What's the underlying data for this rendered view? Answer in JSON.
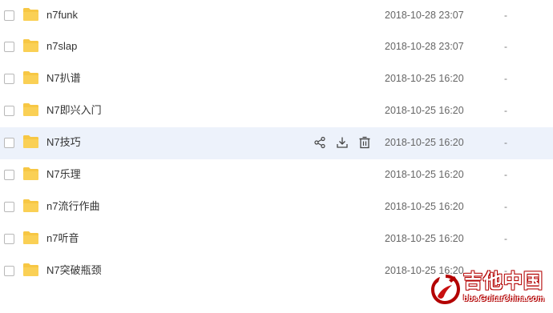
{
  "files": [
    {
      "name": "n7funk",
      "modified": "2018-10-28 23:07",
      "size": "-",
      "type": "folder"
    },
    {
      "name": "n7slap",
      "modified": "2018-10-28 23:07",
      "size": "-",
      "type": "folder"
    },
    {
      "name": "N7扒谱",
      "modified": "2018-10-25 16:20",
      "size": "-",
      "type": "folder"
    },
    {
      "name": "N7即兴入门",
      "modified": "2018-10-25 16:20",
      "size": "-",
      "type": "folder"
    },
    {
      "name": "N7技巧",
      "modified": "2018-10-25 16:20",
      "size": "-",
      "type": "folder",
      "hovered": true
    },
    {
      "name": "N7乐理",
      "modified": "2018-10-25 16:20",
      "size": "-",
      "type": "folder"
    },
    {
      "name": "n7流行作曲",
      "modified": "2018-10-25 16:20",
      "size": "-",
      "type": "folder"
    },
    {
      "name": "n7听音",
      "modified": "2018-10-25 16:20",
      "size": "-",
      "type": "folder"
    },
    {
      "name": "N7突破瓶颈",
      "modified": "2018-10-25 16:20",
      "size": "-",
      "type": "folder"
    }
  ],
  "row_actions": [
    "share-icon",
    "download-icon",
    "delete-icon"
  ],
  "watermark": {
    "title": "吉他中国",
    "url": "bbs.GuitarChina.com"
  },
  "colors": {
    "folder": "#f7c744",
    "hover_row": "#edf2fb",
    "icon": "#444444",
    "watermark": "#b30000"
  }
}
